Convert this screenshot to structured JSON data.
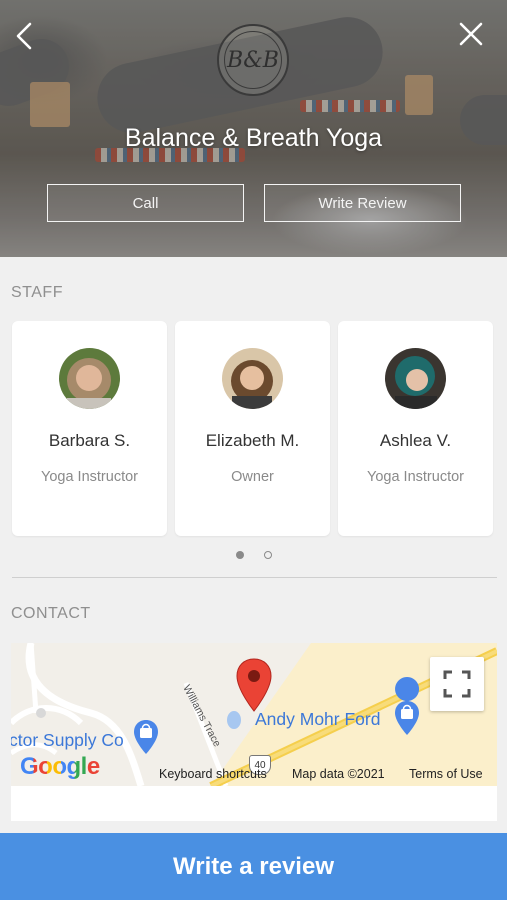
{
  "header": {
    "title": "Balance & Breath Yoga",
    "logo_text": "B&B",
    "call_label": "Call",
    "write_review_label": "Write Review"
  },
  "staff": {
    "section_label": "STAFF",
    "members": [
      {
        "name": "Barbara S.",
        "role": "Yoga Instructor"
      },
      {
        "name": "Elizabeth M.",
        "role": "Owner"
      },
      {
        "name": "Ashlea V.",
        "role": "Yoga Instructor"
      }
    ],
    "pager": {
      "pages": 2,
      "current": 1
    }
  },
  "contact": {
    "section_label": "CONTACT",
    "map": {
      "place_label": "Andy Mohr Ford",
      "place_label_2": "ctor Supply Co",
      "street_label": "Williams Trace",
      "road_shield": "40",
      "google_logo": "Google",
      "keyboard_shortcuts": "Keyboard shortcuts",
      "map_data": "Map data ©2021",
      "terms": "Terms of Use"
    }
  },
  "footer": {
    "write_review_label": "Write a review"
  },
  "colors": {
    "accent": "#4a90e2",
    "map_pin": "#ea4335",
    "map_label": "#3c78d8"
  }
}
